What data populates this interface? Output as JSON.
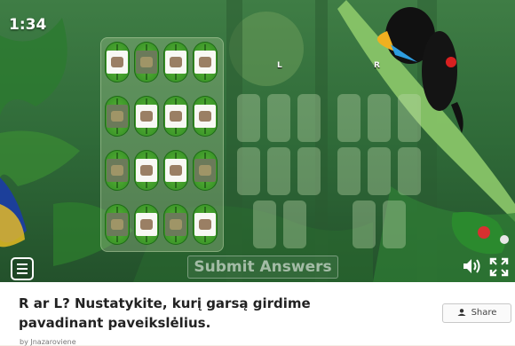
{
  "game": {
    "timer": "1:34",
    "left_label": "L",
    "right_label": "R",
    "submit_label": "Submit Answers",
    "palette_items": [
      {
        "icon": "car-photo-icon",
        "tone": "light"
      },
      {
        "icon": "rock-photo-icon",
        "tone": "dark"
      },
      {
        "icon": "tractor-photo-icon",
        "tone": "light"
      },
      {
        "icon": "robot-photo-icon",
        "tone": "light"
      },
      {
        "icon": "hedgehog-photo-icon",
        "tone": "dark"
      },
      {
        "icon": "crab-photo-icon",
        "tone": "light"
      },
      {
        "icon": "eraser-photo-icon",
        "tone": "light"
      },
      {
        "icon": "knight-photo-icon",
        "tone": "light"
      },
      {
        "icon": "lion-photo-icon",
        "tone": "dark"
      },
      {
        "icon": "mushroom-photo-icon",
        "tone": "light"
      },
      {
        "icon": "lips-photo-icon",
        "tone": "light"
      },
      {
        "icon": "tower-photo-icon",
        "tone": "dark"
      },
      {
        "icon": "ship-photo-icon",
        "tone": "dark"
      },
      {
        "icon": "car-toy-photo-icon",
        "tone": "light"
      },
      {
        "icon": "animal-photo-icon",
        "tone": "dark"
      },
      {
        "icon": "pavilion-photo-icon",
        "tone": "light"
      }
    ]
  },
  "controls": {
    "menu_icon": "menu-icon",
    "audio_icon": "speaker-icon",
    "fullscreen_icon": "fullscreen-icon"
  },
  "activity": {
    "title": "R ar L? Nustatykite, kurį garsą girdime pavadinant paveikslėlius.",
    "share_label": "Share",
    "byline": "by Jnazaroviene"
  },
  "colors": {
    "jungle_dark": "#1f4d2a",
    "leaf_green": "#4aa52e",
    "slot": "#bed7aa"
  }
}
